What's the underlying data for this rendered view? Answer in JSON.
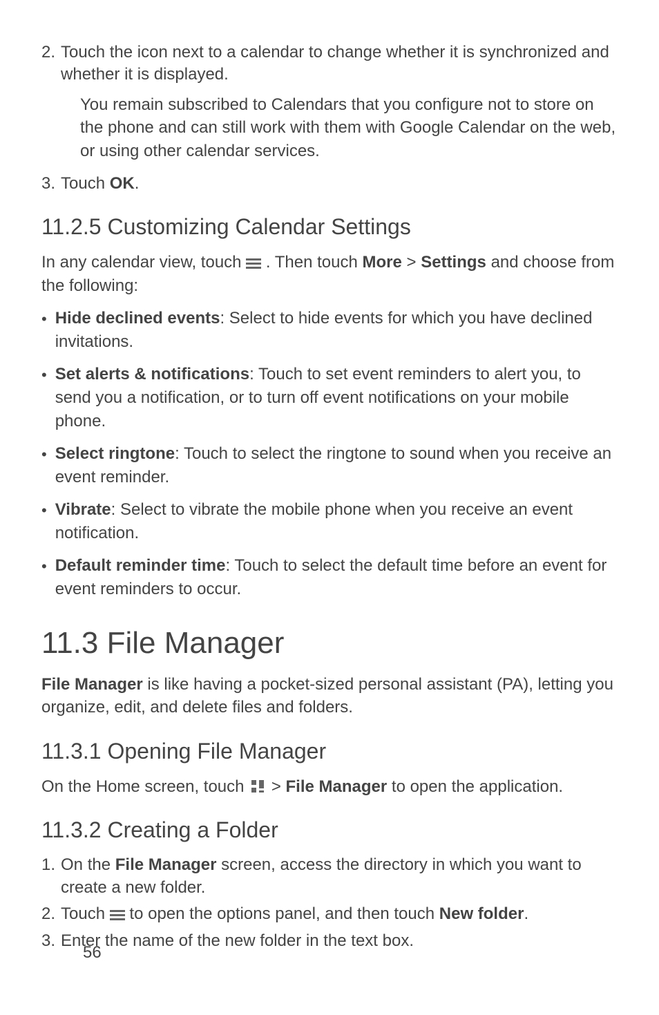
{
  "steps_top": [
    {
      "num": "2.",
      "text": "Touch the icon next to a calendar to change whether it is synchronized and whether it is displayed."
    },
    {
      "num": "3.",
      "text_prefix": "Touch ",
      "bold": "OK",
      "text_suffix": "."
    }
  ],
  "step2_note": "You remain subscribed to Calendars that you configure not to store on the phone and can still work with them with Google Calendar on the web, or using other calendar services.",
  "h_1125": "11.2.5  Customizing Calendar Settings",
  "p_1125_a": "In any calendar view, touch ",
  "p_1125_b": " . Then touch ",
  "p_1125_more": "More",
  "p_1125_gt": " > ",
  "p_1125_settings": "Settings",
  "p_1125_c": " and choose from the following:",
  "bullets": [
    {
      "bold": "Hide declined events",
      "rest": ": Select to hide events for which you have declined invitations."
    },
    {
      "bold": "Set alerts & notifications",
      "rest": ": Touch to set event reminders to alert you, to send you a notification, or to turn off event notifications on your mobile phone."
    },
    {
      "bold": "Select ringtone",
      "rest": ": Touch to select the ringtone to sound when you receive an event reminder."
    },
    {
      "bold": "Vibrate",
      "rest": ": Select to vibrate the mobile phone when you receive an event notification."
    },
    {
      "bold": "Default reminder time",
      "rest": ": Touch to select the default time before an event for event reminders to occur."
    }
  ],
  "h_113": "11.3  File Manager",
  "p_113_bold": "File Manager",
  "p_113_rest": " is like having a pocket-sized personal assistant (PA), letting you organize, edit, and delete files and folders.",
  "h_1131": "11.3.1  Opening File Manager",
  "p_1131_a": "On the Home screen, touch ",
  "p_1131_b": "  > ",
  "p_1131_bold": "File Manager",
  "p_1131_c": " to open the application.",
  "h_1132": "11.3.2  Creating a Folder",
  "steps_1132": [
    {
      "num": "1.",
      "pre": "On the ",
      "bold": "File Manager",
      "post": " screen, access the directory in which you want to create a new folder."
    },
    {
      "num": "2.",
      "pre": "Touch ",
      "icon": "menu",
      "mid": " to open the options panel, and then touch ",
      "bold": "New folder",
      "post": "."
    },
    {
      "num": "3.",
      "pre": "Enter the name of the new folder in the text box.",
      "bold": "",
      "post": ""
    }
  ],
  "page_number": "56"
}
